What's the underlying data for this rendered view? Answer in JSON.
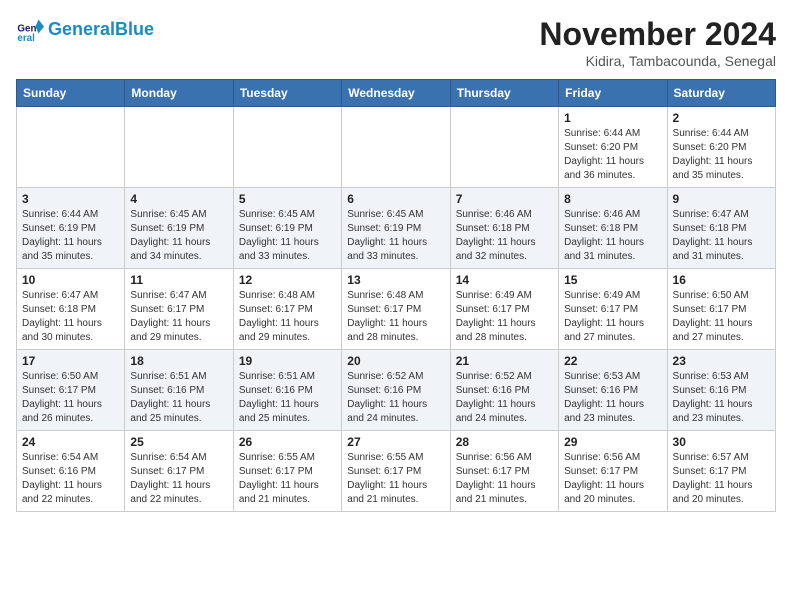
{
  "header": {
    "logo_line1": "General",
    "logo_line2": "Blue",
    "month_title": "November 2024",
    "subtitle": "Kidira, Tambacounda, Senegal"
  },
  "weekdays": [
    "Sunday",
    "Monday",
    "Tuesday",
    "Wednesday",
    "Thursday",
    "Friday",
    "Saturday"
  ],
  "weeks": [
    [
      {
        "day": "",
        "info": ""
      },
      {
        "day": "",
        "info": ""
      },
      {
        "day": "",
        "info": ""
      },
      {
        "day": "",
        "info": ""
      },
      {
        "day": "",
        "info": ""
      },
      {
        "day": "1",
        "info": "Sunrise: 6:44 AM\nSunset: 6:20 PM\nDaylight: 11 hours and 36 minutes."
      },
      {
        "day": "2",
        "info": "Sunrise: 6:44 AM\nSunset: 6:20 PM\nDaylight: 11 hours and 35 minutes."
      }
    ],
    [
      {
        "day": "3",
        "info": "Sunrise: 6:44 AM\nSunset: 6:19 PM\nDaylight: 11 hours and 35 minutes."
      },
      {
        "day": "4",
        "info": "Sunrise: 6:45 AM\nSunset: 6:19 PM\nDaylight: 11 hours and 34 minutes."
      },
      {
        "day": "5",
        "info": "Sunrise: 6:45 AM\nSunset: 6:19 PM\nDaylight: 11 hours and 33 minutes."
      },
      {
        "day": "6",
        "info": "Sunrise: 6:45 AM\nSunset: 6:19 PM\nDaylight: 11 hours and 33 minutes."
      },
      {
        "day": "7",
        "info": "Sunrise: 6:46 AM\nSunset: 6:18 PM\nDaylight: 11 hours and 32 minutes."
      },
      {
        "day": "8",
        "info": "Sunrise: 6:46 AM\nSunset: 6:18 PM\nDaylight: 11 hours and 31 minutes."
      },
      {
        "day": "9",
        "info": "Sunrise: 6:47 AM\nSunset: 6:18 PM\nDaylight: 11 hours and 31 minutes."
      }
    ],
    [
      {
        "day": "10",
        "info": "Sunrise: 6:47 AM\nSunset: 6:18 PM\nDaylight: 11 hours and 30 minutes."
      },
      {
        "day": "11",
        "info": "Sunrise: 6:47 AM\nSunset: 6:17 PM\nDaylight: 11 hours and 29 minutes."
      },
      {
        "day": "12",
        "info": "Sunrise: 6:48 AM\nSunset: 6:17 PM\nDaylight: 11 hours and 29 minutes."
      },
      {
        "day": "13",
        "info": "Sunrise: 6:48 AM\nSunset: 6:17 PM\nDaylight: 11 hours and 28 minutes."
      },
      {
        "day": "14",
        "info": "Sunrise: 6:49 AM\nSunset: 6:17 PM\nDaylight: 11 hours and 28 minutes."
      },
      {
        "day": "15",
        "info": "Sunrise: 6:49 AM\nSunset: 6:17 PM\nDaylight: 11 hours and 27 minutes."
      },
      {
        "day": "16",
        "info": "Sunrise: 6:50 AM\nSunset: 6:17 PM\nDaylight: 11 hours and 27 minutes."
      }
    ],
    [
      {
        "day": "17",
        "info": "Sunrise: 6:50 AM\nSunset: 6:17 PM\nDaylight: 11 hours and 26 minutes."
      },
      {
        "day": "18",
        "info": "Sunrise: 6:51 AM\nSunset: 6:16 PM\nDaylight: 11 hours and 25 minutes."
      },
      {
        "day": "19",
        "info": "Sunrise: 6:51 AM\nSunset: 6:16 PM\nDaylight: 11 hours and 25 minutes."
      },
      {
        "day": "20",
        "info": "Sunrise: 6:52 AM\nSunset: 6:16 PM\nDaylight: 11 hours and 24 minutes."
      },
      {
        "day": "21",
        "info": "Sunrise: 6:52 AM\nSunset: 6:16 PM\nDaylight: 11 hours and 24 minutes."
      },
      {
        "day": "22",
        "info": "Sunrise: 6:53 AM\nSunset: 6:16 PM\nDaylight: 11 hours and 23 minutes."
      },
      {
        "day": "23",
        "info": "Sunrise: 6:53 AM\nSunset: 6:16 PM\nDaylight: 11 hours and 23 minutes."
      }
    ],
    [
      {
        "day": "24",
        "info": "Sunrise: 6:54 AM\nSunset: 6:16 PM\nDaylight: 11 hours and 22 minutes."
      },
      {
        "day": "25",
        "info": "Sunrise: 6:54 AM\nSunset: 6:17 PM\nDaylight: 11 hours and 22 minutes."
      },
      {
        "day": "26",
        "info": "Sunrise: 6:55 AM\nSunset: 6:17 PM\nDaylight: 11 hours and 21 minutes."
      },
      {
        "day": "27",
        "info": "Sunrise: 6:55 AM\nSunset: 6:17 PM\nDaylight: 11 hours and 21 minutes."
      },
      {
        "day": "28",
        "info": "Sunrise: 6:56 AM\nSunset: 6:17 PM\nDaylight: 11 hours and 21 minutes."
      },
      {
        "day": "29",
        "info": "Sunrise: 6:56 AM\nSunset: 6:17 PM\nDaylight: 11 hours and 20 minutes."
      },
      {
        "day": "30",
        "info": "Sunrise: 6:57 AM\nSunset: 6:17 PM\nDaylight: 11 hours and 20 minutes."
      }
    ]
  ]
}
